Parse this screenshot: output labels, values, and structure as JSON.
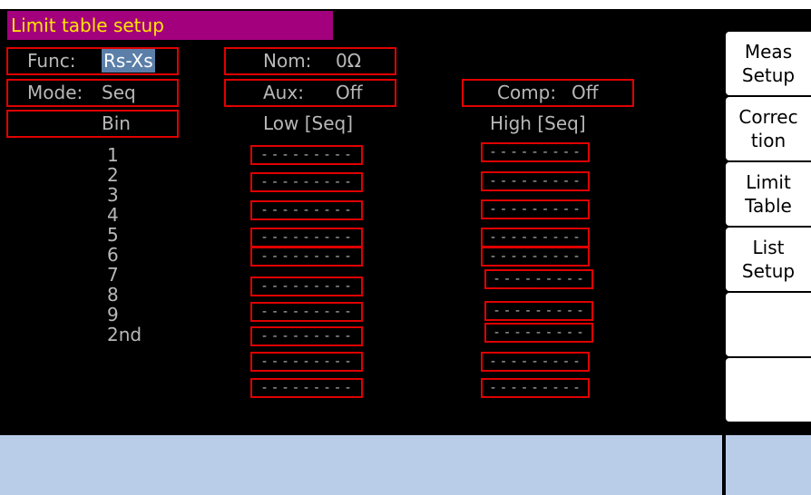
{
  "header": {
    "title": "Limit table setup"
  },
  "fields": {
    "func_label": "Func:",
    "func_value": "Rs-Xs",
    "nom_label": "Nom:",
    "nom_value": "0Ω",
    "mode_label": "Mode:",
    "mode_value": "Seq",
    "aux_label": "Aux:",
    "aux_value": "Off",
    "comp_label": "Comp:",
    "comp_value": "Off"
  },
  "table": {
    "col_bin": "Bin",
    "col_low": "Low  [Seq]",
    "col_high": "High  [Seq]",
    "rows": [
      {
        "bin": "1",
        "low": "- - - - - - - - -",
        "high": "- - - - - - - - -"
      },
      {
        "bin": "2",
        "low": "- - - - - - - - -",
        "high": "- - - - - - - - -"
      },
      {
        "bin": "3",
        "low": "- - - - - - - - -",
        "high": "- - - - - - - - -"
      },
      {
        "bin": "4",
        "low": "- - - - - - - - -",
        "high": "- - - - - - - - -"
      },
      {
        "bin": "5",
        "low": "- - - - - - - - -",
        "high": "- - - - - - - - -"
      },
      {
        "bin": "6",
        "low": "- - - - - - - - -",
        "high": "- - - - - - - - -"
      },
      {
        "bin": "7",
        "low": "- - - - - - - - -",
        "high": "- - - - - - - - -"
      },
      {
        "bin": "8",
        "low": "- - - - - - - - -",
        "high": "- - - - - - - - -"
      },
      {
        "bin": "9",
        "low": "- - - - - - - - -",
        "high": "- - - - - - - - -"
      },
      {
        "bin": "2nd",
        "low": "- - - - - - - - -",
        "high": "- - - - - - - - -"
      }
    ]
  },
  "softkeys": [
    "Meas Setup",
    "Correc tion",
    "Limit Table",
    "List Setup",
    "",
    ""
  ]
}
